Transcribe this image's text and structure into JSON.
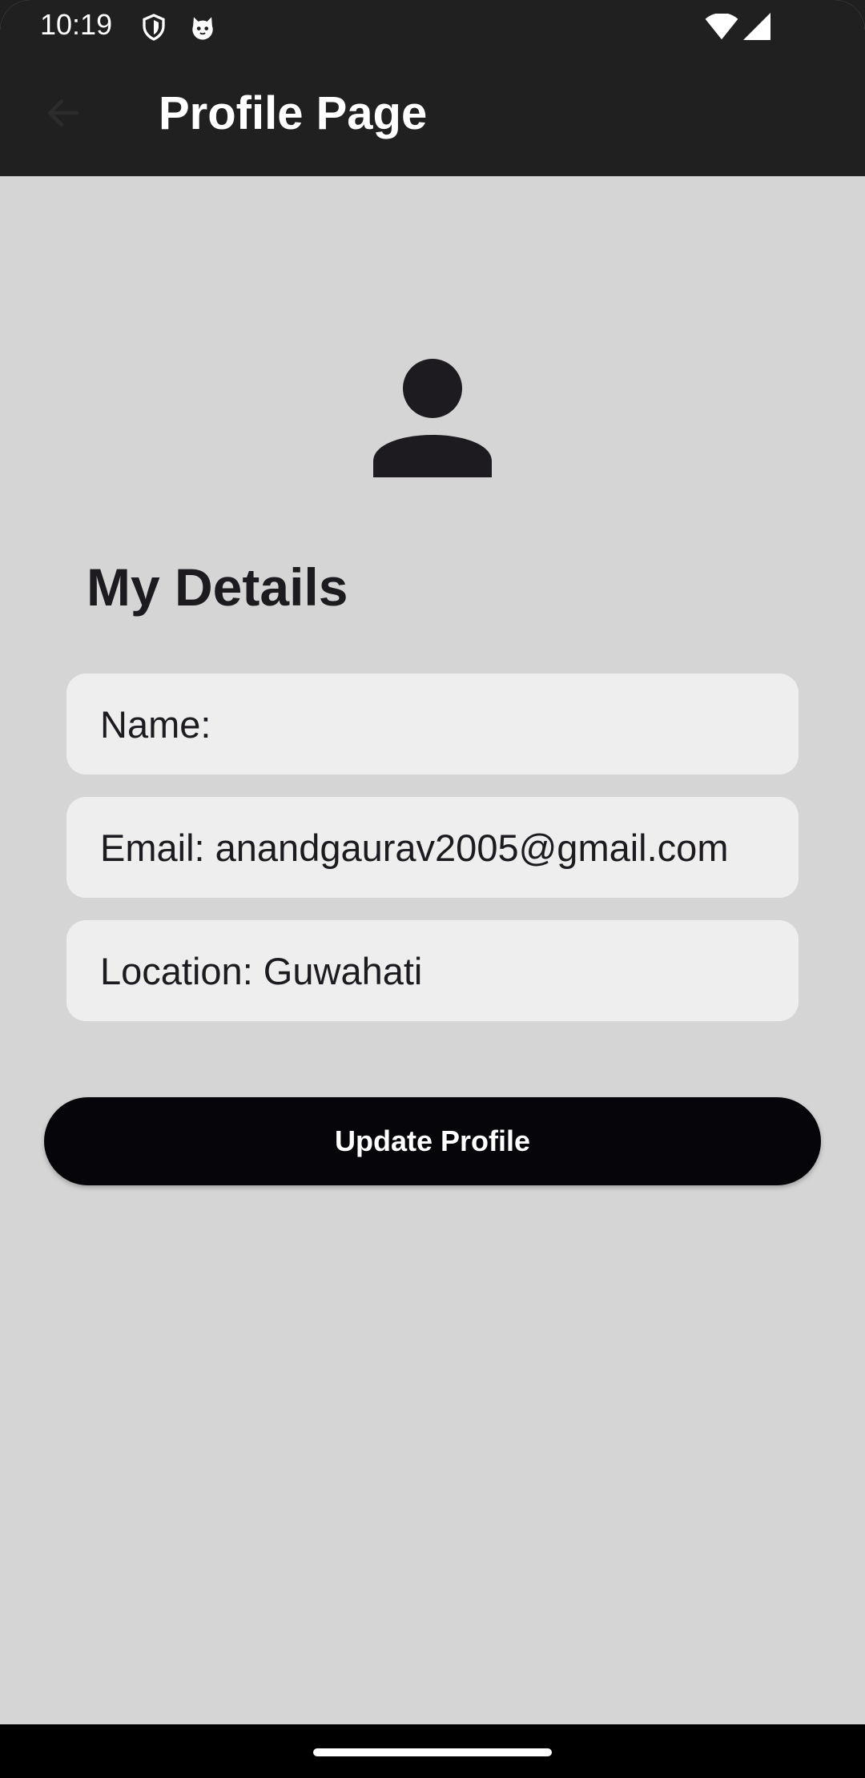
{
  "status_bar": {
    "time": "10:19",
    "icons": [
      "shield-icon",
      "cat-icon",
      "wifi-icon",
      "signal-icon"
    ]
  },
  "app_bar": {
    "back_icon": "arrow-back-icon",
    "title": "Profile Page"
  },
  "profile": {
    "avatar_icon": "person-icon",
    "section_title": "My Details",
    "fields": [
      {
        "text": "Name:"
      },
      {
        "text": "Email: anandgaurav2005@gmail.com"
      },
      {
        "text": "Location: Guwahati"
      }
    ],
    "update_button_label": "Update Profile"
  },
  "colors": {
    "app_bar_bg": "#202020",
    "page_bg": "#d5d5d5",
    "field_bg": "#eeeeee",
    "button_bg": "#06060a",
    "text_dark": "#1d1b20"
  }
}
